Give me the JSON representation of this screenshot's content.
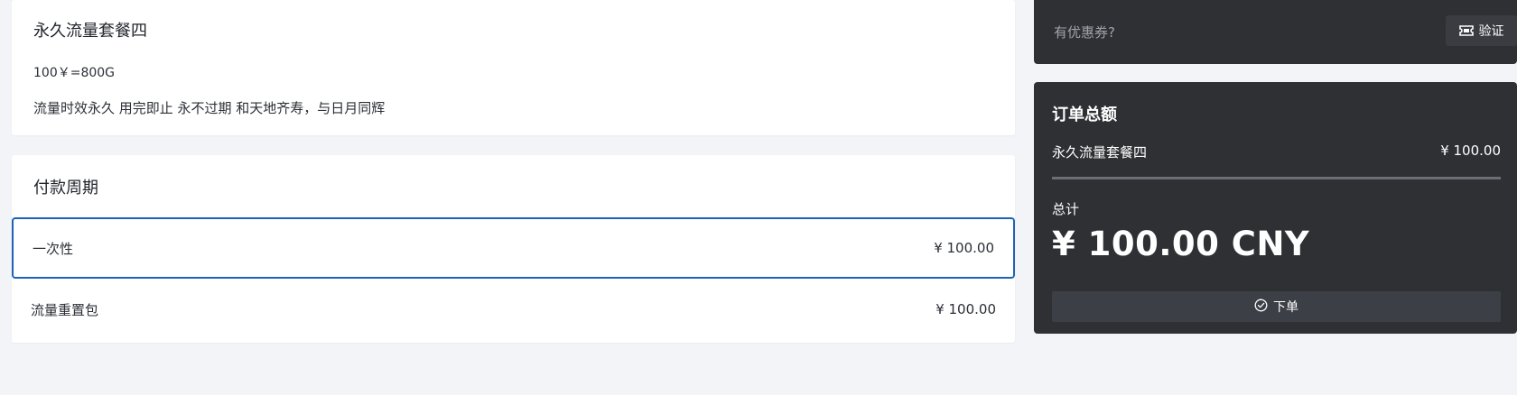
{
  "plan": {
    "name": "永久流量套餐四",
    "price_line": "100￥=800G",
    "description": "流量时效永久 用完即止 永不过期 和天地齐寿，与日月同辉"
  },
  "payment": {
    "heading": "付款周期",
    "options": [
      {
        "label": "一次性",
        "price": "¥ 100.00",
        "selected": true
      },
      {
        "label": "流量重置包",
        "price": "¥ 100.00",
        "selected": false
      }
    ]
  },
  "coupon": {
    "placeholder": "有优惠券?",
    "verify_label": "验证",
    "verify_icon": "ticket-icon"
  },
  "summary": {
    "heading": "订单总额",
    "item_name": "永久流量套餐四",
    "item_price": "¥ 100.00",
    "total_label": "总计",
    "total_amount": "¥ 100.00 CNY",
    "order_label": "下单",
    "order_icon": "check-circle-icon"
  },
  "colors": {
    "background": "#f2f4f8",
    "panel": "#2f3034",
    "accent_border": "#1d63b5"
  }
}
